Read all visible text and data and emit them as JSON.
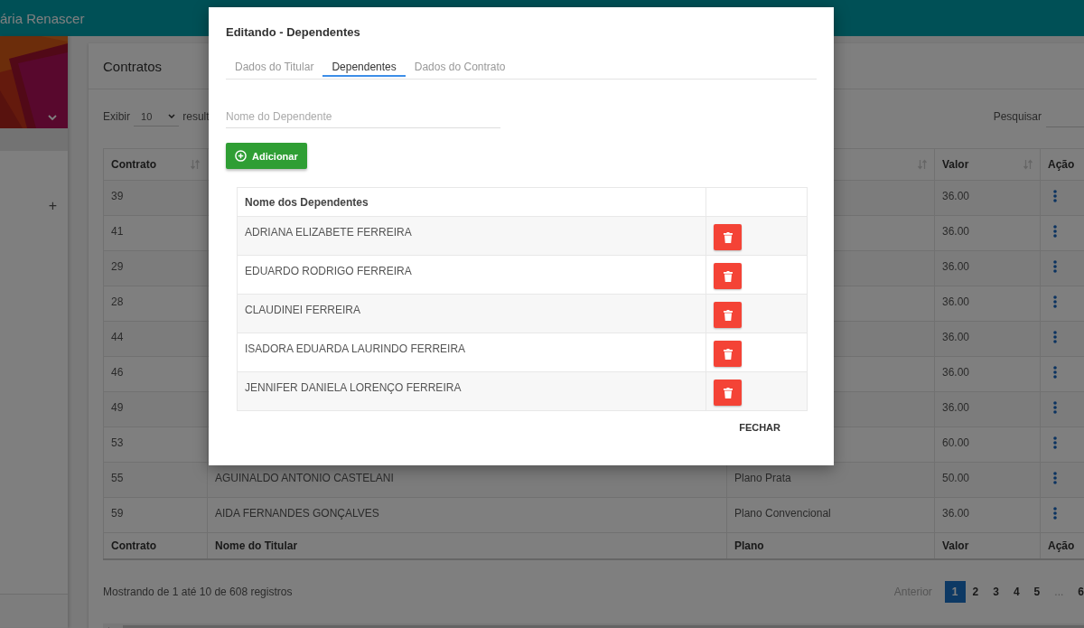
{
  "app": {
    "brand": "ária Renascer"
  },
  "sidebar": {
    "expand_symbol": "+"
  },
  "contracts": {
    "title": "Contratos",
    "show_label": "Exibir",
    "page_size": "10",
    "show_suffix": "result",
    "search_label": "Pesquisar",
    "columns": [
      {
        "label": "Contrato",
        "sortable": true
      },
      {},
      {
        "sortable": true
      },
      {
        "label": "Valor",
        "sortable": true
      },
      {
        "label": "Ação"
      }
    ],
    "rows": [
      {
        "contract": "39",
        "value": "36.00"
      },
      {
        "contract": "41",
        "value": "36.00"
      },
      {
        "contract": "29",
        "value": "36.00"
      },
      {
        "contract": "28",
        "value": "36.00"
      },
      {
        "contract": "44",
        "value": "36.00"
      },
      {
        "contract": "46",
        "value": "36.00"
      },
      {
        "contract": "49",
        "value": "36.00"
      },
      {
        "contract": "53",
        "value": "60.00"
      },
      {
        "contract": "55",
        "name": "AGUINALDO ANTONIO CASTELANI",
        "plan": "Plano Prata",
        "value": "50.00"
      },
      {
        "contract": "59",
        "name": "AIDA FERNANDES GONÇALVES",
        "plan": "Plano Convencional",
        "value": "36.00"
      }
    ],
    "footer_columns": [
      "Contrato",
      "Nome do Titular",
      "Plano",
      "Valor",
      "Ação"
    ],
    "info": "Mostrando de 1 até 10 de 608 registros",
    "pagination": {
      "previous": "Anterior",
      "pages": [
        {
          "label": "1",
          "selected": true,
          "kind": "page"
        },
        {
          "label": "2",
          "selected": false,
          "kind": "page"
        },
        {
          "label": "3",
          "selected": false,
          "kind": "page"
        },
        {
          "label": "4",
          "selected": false,
          "kind": "page"
        },
        {
          "label": "5",
          "selected": false,
          "kind": "page"
        },
        {
          "label": "...",
          "selected": false,
          "kind": "ellipsis"
        },
        {
          "label": "6",
          "selected": false,
          "kind": "page"
        }
      ]
    }
  },
  "modal": {
    "title": "Editando - Dependentes",
    "tabs": [
      {
        "label": "Dados do Titular",
        "selected": false
      },
      {
        "label": "Dependentes",
        "selected": true
      },
      {
        "label": "Dados do Contrato",
        "selected": false
      }
    ],
    "name_field": {
      "placeholder": "Nome do Dependente"
    },
    "add_button": "Adicionar",
    "dependents_header": "Nome dos Dependentes",
    "dependents": [
      "ADRIANA ELIZABETE FERREIRA",
      "EDUARDO RODRIGO FERREIRA",
      "CLAUDINEI FERREIRA",
      "ISADORA EDUARDA LAURINDO FERREIRA",
      "JENNIFER DANIELA LORENÇO FERREIRA"
    ],
    "close_button": "FECHAR"
  }
}
